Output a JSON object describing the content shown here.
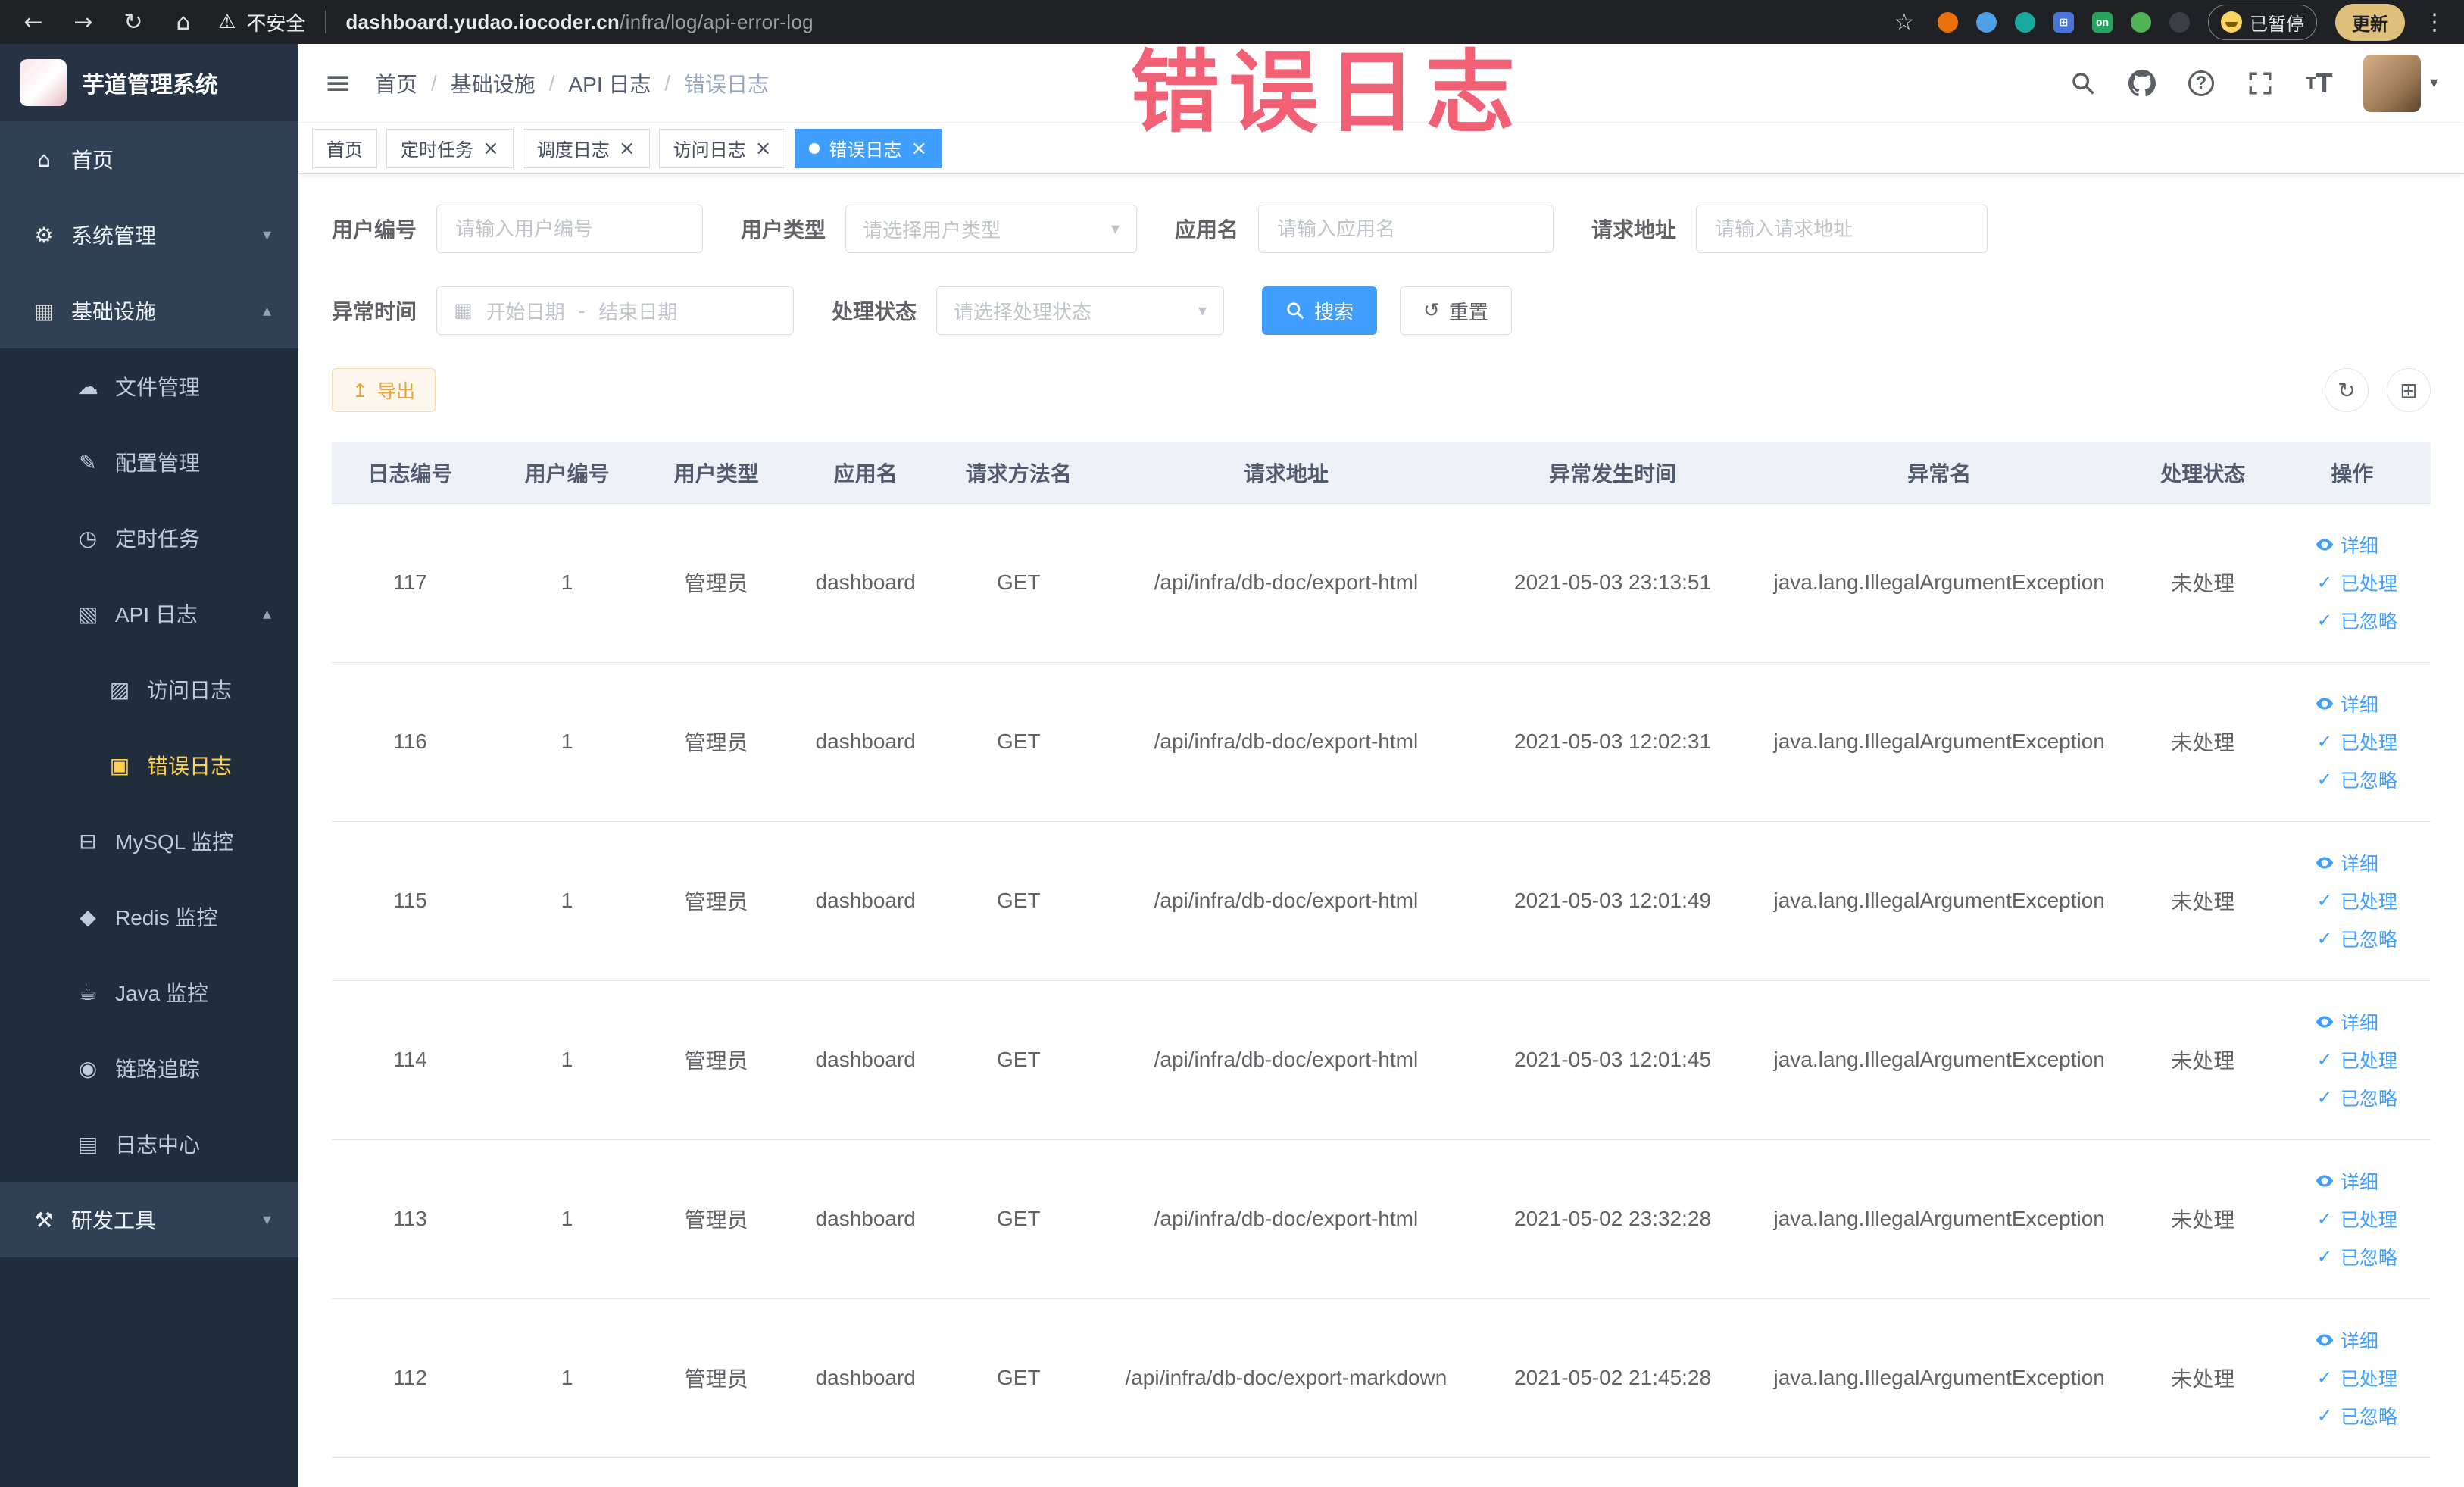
{
  "browser": {
    "security_label": "不安全",
    "url_domain": "dashboard.yudao.iocoder.cn",
    "url_path": "/infra/log/api-error-log",
    "on_badge": "on",
    "paused_badge": "已暂停",
    "update_button": "更新"
  },
  "annotation": {
    "text": "错误日志"
  },
  "icons": {
    "back": "←",
    "forward": "→",
    "reload": "↻",
    "home": "⌂",
    "warning": "⚠",
    "star": "☆",
    "kebab": "⋮",
    "menu": "≡",
    "caret_down": "▾",
    "caret_up": "▴",
    "home_menu": "⌂",
    "gear": "⚙",
    "grid": "▦",
    "cloud": "☁",
    "edit": "✎",
    "clock": "◷",
    "api_log": "▧",
    "access_log": "▨",
    "error_log": "▣",
    "mysql": "⊟",
    "redis": "◆",
    "java": "☕",
    "trace": "◉",
    "log_center": "▤",
    "tools": "⚒",
    "question": "?",
    "fontsize": "T",
    "calendar": "▦",
    "reset": "↺",
    "refresh": "↻",
    "columns": "⊞",
    "export": "↥",
    "check": "✓",
    "close": "×"
  },
  "sidebar": {
    "logo_title": "芋道管理系统",
    "items": [
      {
        "label": "首页"
      },
      {
        "label": "系统管理"
      },
      {
        "label": "基础设施"
      },
      {
        "label": "文件管理"
      },
      {
        "label": "配置管理"
      },
      {
        "label": "定时任务"
      },
      {
        "label": "API 日志"
      },
      {
        "label": "访问日志"
      },
      {
        "label": "错误日志"
      },
      {
        "label": "MySQL 监控"
      },
      {
        "label": "Redis 监控"
      },
      {
        "label": "Java 监控"
      },
      {
        "label": "链路追踪"
      },
      {
        "label": "日志中心"
      },
      {
        "label": "研发工具"
      }
    ]
  },
  "breadcrumb": {
    "items": [
      "首页",
      "基础设施",
      "API 日志",
      "错误日志"
    ]
  },
  "tabs": [
    {
      "label": "首页"
    },
    {
      "label": "定时任务"
    },
    {
      "label": "调度日志"
    },
    {
      "label": "访问日志"
    },
    {
      "label": "错误日志"
    }
  ],
  "filters": {
    "user_id_label": "用户编号",
    "user_id_placeholder": "请输入用户编号",
    "user_type_label": "用户类型",
    "user_type_placeholder": "请选择用户类型",
    "app_name_label": "应用名",
    "app_name_placeholder": "请输入应用名",
    "request_url_label": "请求地址",
    "request_url_placeholder": "请输入请求地址",
    "exception_time_label": "异常时间",
    "date_start_placeholder": "开始日期",
    "date_separator": "-",
    "date_end_placeholder": "结束日期",
    "process_status_label": "处理状态",
    "process_status_placeholder": "请选择处理状态",
    "search_button": "搜索",
    "reset_button": "重置"
  },
  "toolbar": {
    "export_button": "导出"
  },
  "table": {
    "columns": [
      "日志编号",
      "用户编号",
      "用户类型",
      "应用名",
      "请求方法名",
      "请求地址",
      "异常发生时间",
      "异常名",
      "处理状态",
      "操作"
    ],
    "actions": [
      "详细",
      "已处理",
      "已忽略"
    ],
    "rows": [
      {
        "id": "117",
        "user_id": "1",
        "user_type": "管理员",
        "app": "dashboard",
        "method": "GET",
        "url": "/api/infra/db-doc/export-html",
        "time": "2021-05-03 23:13:51",
        "exception": "java.lang.IllegalArgumentException",
        "status": "未处理"
      },
      {
        "id": "116",
        "user_id": "1",
        "user_type": "管理员",
        "app": "dashboard",
        "method": "GET",
        "url": "/api/infra/db-doc/export-html",
        "time": "2021-05-03 12:02:31",
        "exception": "java.lang.IllegalArgumentException",
        "status": "未处理"
      },
      {
        "id": "115",
        "user_id": "1",
        "user_type": "管理员",
        "app": "dashboard",
        "method": "GET",
        "url": "/api/infra/db-doc/export-html",
        "time": "2021-05-03 12:01:49",
        "exception": "java.lang.IllegalArgumentException",
        "status": "未处理"
      },
      {
        "id": "114",
        "user_id": "1",
        "user_type": "管理员",
        "app": "dashboard",
        "method": "GET",
        "url": "/api/infra/db-doc/export-html",
        "time": "2021-05-03 12:01:45",
        "exception": "java.lang.IllegalArgumentException",
        "status": "未处理"
      },
      {
        "id": "113",
        "user_id": "1",
        "user_type": "管理员",
        "app": "dashboard",
        "method": "GET",
        "url": "/api/infra/db-doc/export-html",
        "time": "2021-05-02 23:32:28",
        "exception": "java.lang.IllegalArgumentException",
        "status": "未处理"
      },
      {
        "id": "112",
        "user_id": "1",
        "user_type": "管理员",
        "app": "dashboard",
        "method": "GET",
        "url": "/api/infra/db-doc/export-markdown",
        "time": "2021-05-02 21:45:28",
        "exception": "java.lang.IllegalArgumentException",
        "status": "未处理"
      }
    ]
  }
}
